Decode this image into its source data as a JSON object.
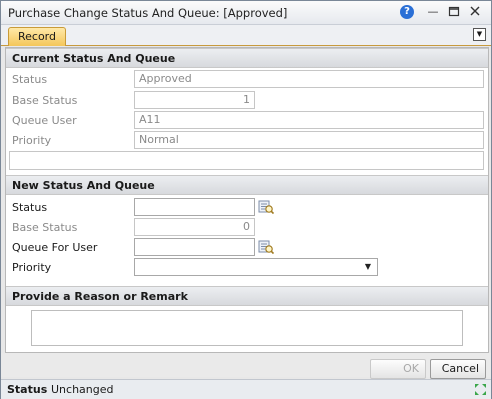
{
  "window": {
    "title": "Purchase Change Status And Queue: [Approved]"
  },
  "tabs": {
    "record": "Record"
  },
  "current": {
    "header": "Current Status And Queue",
    "status_label": "Status",
    "status_value": "Approved",
    "base_status_label": "Base Status",
    "base_status_value": "1",
    "queue_user_label": "Queue User",
    "queue_user_value": "A11",
    "priority_label": "Priority",
    "priority_value": "Normal"
  },
  "new": {
    "header": "New Status And Queue",
    "status_label": "Status",
    "status_value": "",
    "base_status_label": "Base Status",
    "base_status_value": "0",
    "queue_user_label": "Queue For User",
    "queue_user_value": "",
    "priority_label": "Priority",
    "priority_value": ""
  },
  "reason": {
    "header": "Provide a Reason or Remark"
  },
  "buttons": {
    "ok": "OK",
    "cancel": "Cancel"
  },
  "statusbar": {
    "label": "Status",
    "value": "Unchanged"
  }
}
